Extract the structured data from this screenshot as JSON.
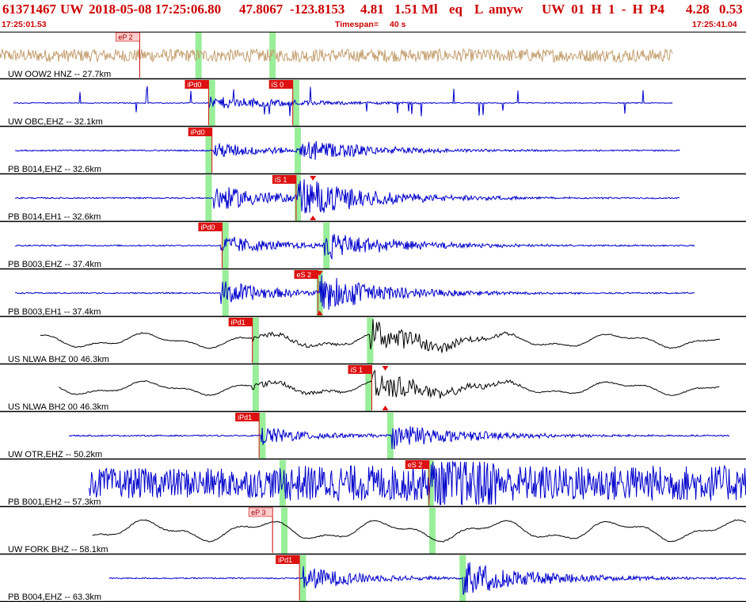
{
  "header": {
    "event_id": "61371467",
    "network": "UW",
    "datetime": "2018-05-08 17:25:06.80",
    "lat": "47.8067",
    "lon": "-123.8153",
    "depth": "4.81",
    "magnitude": "1.51 Ml",
    "event_type": "eq",
    "flag": "L",
    "analyst": "amyw",
    "quality": "UW 01 H 1 - H P4",
    "rms": "4.28",
    "err": "0.53"
  },
  "timebar": {
    "start": "17:25:01.53",
    "timespan_label": "Timespan=",
    "timespan_value": "40 s",
    "end": "17:25:41.04"
  },
  "colors": {
    "header_text": "#cc0000",
    "trace_blue": "#0000cc",
    "trace_black": "#000000",
    "trace_tan": "#c4a070",
    "pick_window": "#99ee99",
    "pick_label_bg": "#dd1111",
    "pick_label_bg_light": "#ffcccc",
    "separator": "#000000"
  },
  "chart_data": {
    "type": "seismogram",
    "time_window": {
      "start": "17:25:01.53",
      "end": "17:25:41.04",
      "span_s": 40
    },
    "channels": [
      {
        "label": "UW OOW2 HNZ -- 27.7km",
        "color": "tan",
        "t_start": 0,
        "t_end": 40,
        "signal": "noise",
        "amp": 0.3,
        "picks": [
          {
            "label": "eP 2",
            "t": 8.3,
            "style": "light"
          }
        ],
        "windows": [
          11.8,
          16.2
        ]
      },
      {
        "label": "UW OBC,EHZ -- 32.1km",
        "color": "blue",
        "t_start": 0.8,
        "t_end": 40,
        "signal": "spikes",
        "amp": 0.08,
        "picks": [
          {
            "label": "iPd0",
            "t": 12.4,
            "style": "red"
          },
          {
            "label": "iS 0",
            "t": 17.4,
            "style": "red"
          }
        ],
        "windows": [
          12.6,
          17.6
        ]
      },
      {
        "label": "PB B014,EHZ -- 32.6km",
        "color": "blue",
        "t_start": 0.9,
        "t_end": 40.4,
        "signal": "quake",
        "amp": 0.35,
        "p_time": 12.7,
        "s_time": 17.8,
        "picks": [
          {
            "label": "iPd0",
            "t": 12.6,
            "style": "red"
          }
        ],
        "windows": [
          12.4,
          17.7
        ]
      },
      {
        "label": "PB B014,EH1 -- 32.6km",
        "color": "blue",
        "t_start": 0.9,
        "t_end": 40.4,
        "signal": "quake",
        "amp": 0.6,
        "p_time": 12.7,
        "s_time": 17.7,
        "picks": [
          {
            "label": "iS 1",
            "t": 17.6,
            "style": "red"
          }
        ],
        "windows": [
          12.4,
          17.7
        ],
        "markers": [
          18.6
        ]
      },
      {
        "label": "PB B003,EHZ -- 37.4km",
        "color": "blue",
        "t_start": 0.9,
        "t_end": 41.3,
        "signal": "quake",
        "amp": 0.45,
        "p_time": 13.1,
        "s_time": 19.2,
        "picks": [
          {
            "label": "iPd0",
            "t": 13.2,
            "style": "red"
          }
        ],
        "windows": [
          13.4,
          19.4
        ]
      },
      {
        "label": "PB B003,EH1 -- 37.4km",
        "color": "blue",
        "t_start": 0.9,
        "t_end": 41.3,
        "signal": "quake",
        "amp": 0.55,
        "p_time": 13.1,
        "s_time": 19.0,
        "picks": [
          {
            "label": "eS 2",
            "t": 18.9,
            "style": "red"
          }
        ],
        "windows": [
          13.4,
          19.0
        ],
        "markers": [
          19.0
        ]
      },
      {
        "label": "US NLWA BHZ 00 46.3km",
        "color": "black",
        "t_start": 2.4,
        "t_end": 42.8,
        "signal": "longperiod",
        "amp": 0.42,
        "p_time": 15.0,
        "s_time": 22.0,
        "picks": [
          {
            "label": "iPd1",
            "t": 15.0,
            "style": "red"
          }
        ],
        "windows": [
          15.2,
          22.0
        ]
      },
      {
        "label": "US NLWA BH2 00 46.3km",
        "color": "black",
        "t_start": 3.5,
        "t_end": 42.8,
        "signal": "longperiod",
        "amp": 0.4,
        "p_time": 15.0,
        "s_time": 22.1,
        "picks": [
          {
            "label": "iS 1",
            "t": 22.1,
            "style": "red"
          }
        ],
        "windows": [
          15.2,
          21.9
        ],
        "markers": [
          22.9
        ]
      },
      {
        "label": "UW OTR,EHZ -- 50.2km",
        "color": "blue",
        "t_start": 4.1,
        "t_end": 43.4,
        "signal": "quake",
        "amp": 0.4,
        "p_time": 15.5,
        "s_time": 23.3,
        "picks": [
          {
            "label": "iPd1",
            "t": 15.4,
            "style": "red"
          }
        ],
        "windows": [
          15.6,
          23.2
        ]
      },
      {
        "label": "PB B001,EH2 -- 57.3km",
        "color": "blue",
        "t_start": 5.3,
        "t_end": 44.7,
        "signal": "noise",
        "amp": 0.7,
        "p_time": 16.8,
        "s_time": 25.5,
        "picks": [
          {
            "label": "eS 2",
            "t": 25.5,
            "style": "red"
          }
        ],
        "windows": [
          16.8,
          25.6
        ]
      },
      {
        "label": "UW FORK BHZ -- 58.1km",
        "color": "black",
        "t_start": 5.5,
        "t_end": 44.8,
        "signal": "longperiod",
        "amp": 0.6,
        "picks": [
          {
            "label": "eP 3",
            "t": 16.2,
            "style": "light"
          }
        ],
        "windows": [
          16.9,
          25.7
        ]
      },
      {
        "label": "PB B004,EHZ -- 63.3km",
        "color": "blue",
        "t_start": 6.5,
        "t_end": 45.5,
        "signal": "quake",
        "amp": 0.55,
        "p_time": 18.0,
        "s_time": 27.5,
        "picks": [
          {
            "label": "iPd1",
            "t": 17.8,
            "style": "red"
          }
        ],
        "windows": [
          18.0,
          27.5
        ]
      }
    ]
  }
}
